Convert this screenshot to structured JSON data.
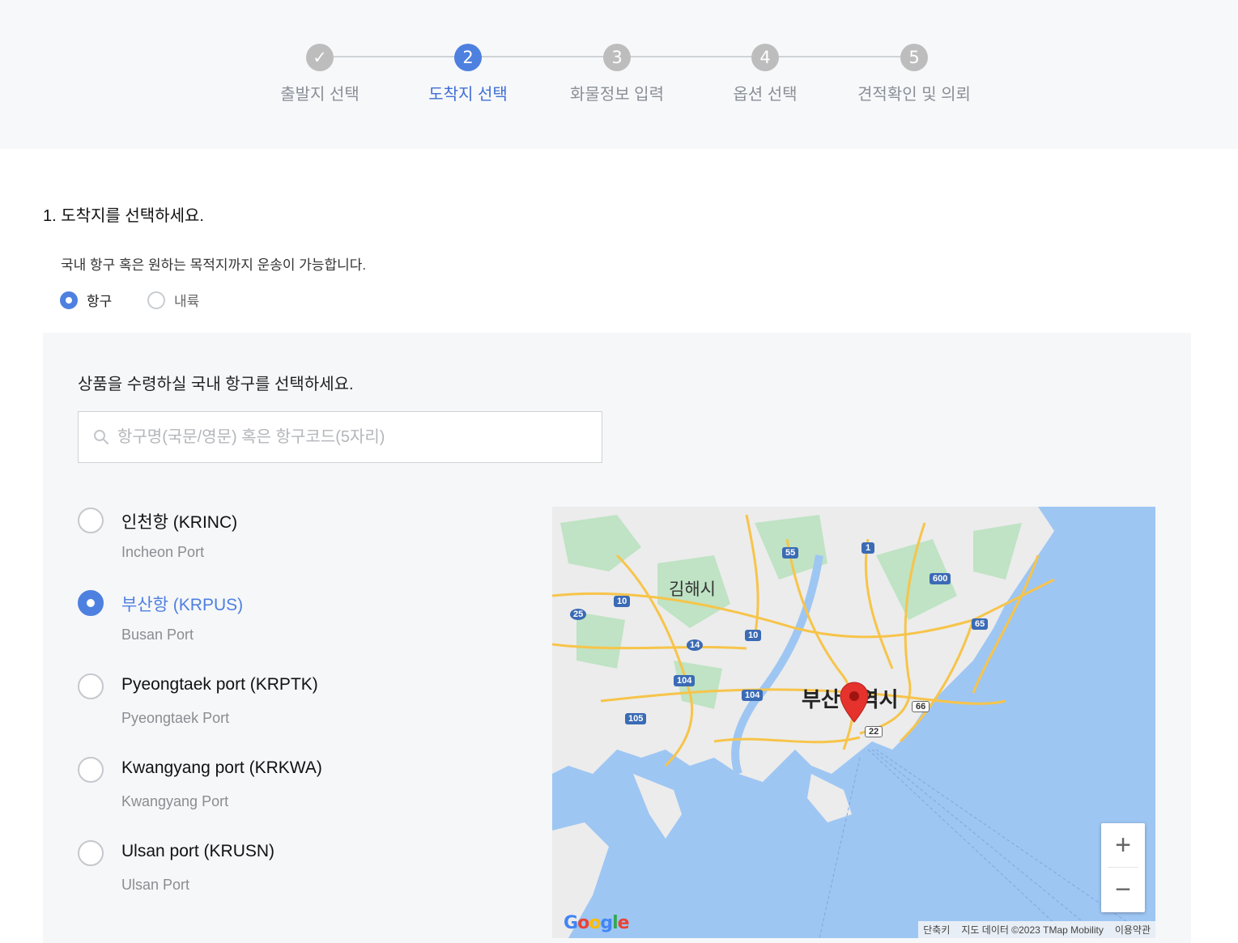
{
  "steps": [
    {
      "num": "✓",
      "label": "출발지 선택",
      "state": "done"
    },
    {
      "num": "2",
      "label": "도착지 선택",
      "state": "active"
    },
    {
      "num": "3",
      "label": "화물정보 입력",
      "state": "pending"
    },
    {
      "num": "4",
      "label": "옵션 선택",
      "state": "pending"
    },
    {
      "num": "5",
      "label": "견적확인 및 의뢰",
      "state": "pending"
    }
  ],
  "section": {
    "title": "1. 도착지를 선택하세요.",
    "description": "국내 항구 혹은 원하는 목적지까지 운송이 가능합니다.",
    "options": [
      {
        "label": "항구",
        "checked": true
      },
      {
        "label": "내륙",
        "checked": false
      }
    ]
  },
  "panel": {
    "title": "상품을 수령하실 국내 항구를 선택하세요.",
    "search_placeholder": "항구명(국문/영문) 혹은 항구코드(5자리)"
  },
  "ports": [
    {
      "name": "인천항 (KRINC)",
      "sub": "Incheon Port",
      "checked": false
    },
    {
      "name": "부산항 (KRPUS)",
      "sub": "Busan Port",
      "checked": true
    },
    {
      "name": "Pyeongtaek port (KRPTK)",
      "sub": "Pyeongtaek Port",
      "checked": false
    },
    {
      "name": "Kwangyang port (KRKWA)",
      "sub": "Kwangyang Port",
      "checked": false
    },
    {
      "name": "Ulsan port (KRUSN)",
      "sub": "Ulsan Port",
      "checked": false
    }
  ],
  "map": {
    "city_label_1": "김해시",
    "city_label_2": "부산광역시",
    "road_shields": [
      "55",
      "1",
      "600",
      "10",
      "25",
      "65",
      "14",
      "10",
      "104",
      "104",
      "105",
      "66",
      "22"
    ],
    "zoom_in": "+",
    "zoom_out": "−",
    "attribution": {
      "shortcuts": "단축키",
      "data": "지도 데이터 ©2023 TMap Mobility",
      "terms": "이용약관"
    },
    "logo": "Google",
    "colors": {
      "water": "#9ec6f3",
      "land": "#ececec",
      "park": "#bfe3c4",
      "road": "#f7c44a",
      "pin": "#e5322d"
    }
  },
  "colors": {
    "accent": "#4e80e0",
    "muted": "#8a8f96"
  }
}
